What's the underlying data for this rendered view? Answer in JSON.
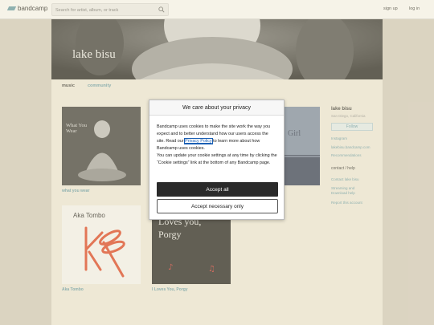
{
  "topbar": {
    "logo_text": "bandcamp",
    "search_placeholder": "Search for artist, album, or track",
    "signup_label": "sign up",
    "login_label": "log in"
  },
  "banner": {
    "title": "lake bisu"
  },
  "tabs": {
    "music": "music",
    "community": "community"
  },
  "albums": [
    {
      "title": "what you wear",
      "cover_text": "What You Wear"
    },
    {
      "title": "Aka Tombo",
      "cover_text": "Aka Tombo"
    },
    {
      "title": "I Loves You, Porgy",
      "cover_text": "Loves you, Porgy"
    },
    {
      "cover_text": "Girl"
    }
  ],
  "sidebar": {
    "artist_name": "lake bisu",
    "location": "San Diego, California",
    "follow_label": "Follow",
    "links": [
      "Instagram",
      "lakebisu.bandcamp.com",
      "Recommendations"
    ],
    "contact_heading": "contact / help",
    "contact_links": [
      "Contact lake bisu",
      "Streaming and Download help",
      "Report this account"
    ]
  },
  "cookie_modal": {
    "title": "We care about your privacy",
    "body_1": "Bandcamp uses cookies to make the site work the way you expect and to better understand how our users access the site. Read our ",
    "policy_link": "Privacy Policy",
    "body_2": " to learn more about how Bandcamp uses cookies.",
    "body_3": "You can update your cookie settings at any time by clicking the “Cookie settings” link at the bottom of any Bandcamp page.",
    "accept_all_label": "Accept all",
    "accept_necessary_label": "Accept necessary only"
  },
  "colors": {
    "accent": "#629aa9",
    "button_dark": "#2a2a2a"
  }
}
